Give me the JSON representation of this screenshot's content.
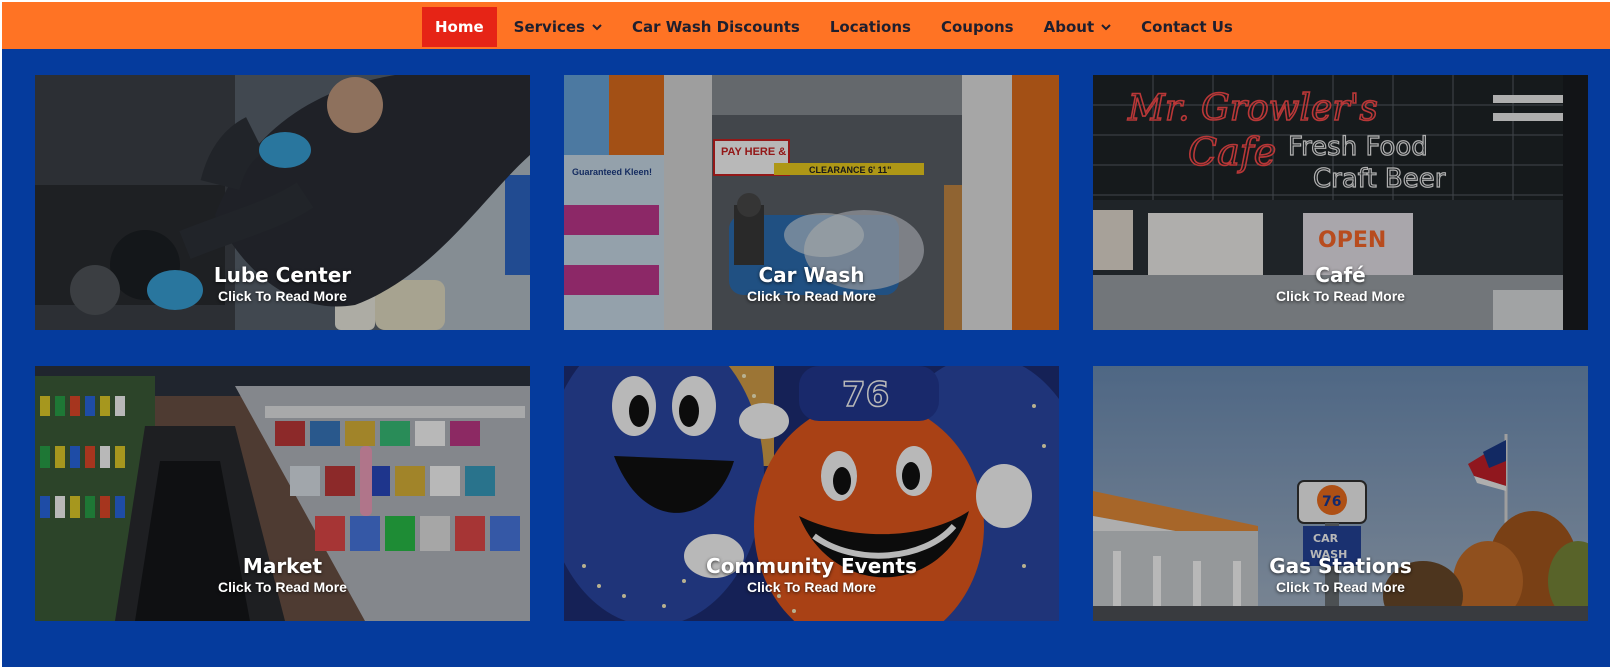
{
  "colors": {
    "nav_background": "#ff7324",
    "nav_active": "#e62416",
    "main_background": "#053b9d",
    "nav_text": "#1f1f2e"
  },
  "nav": {
    "items": [
      {
        "label": "Home",
        "active": true,
        "dropdown": false
      },
      {
        "label": "Services",
        "active": false,
        "dropdown": true,
        "icon": "chevron-down-icon"
      },
      {
        "label": "Car Wash Discounts",
        "active": false,
        "dropdown": false
      },
      {
        "label": "Locations",
        "active": false,
        "dropdown": false
      },
      {
        "label": "Coupons",
        "active": false,
        "dropdown": false
      },
      {
        "label": "About",
        "active": false,
        "dropdown": true,
        "icon": "chevron-down-icon"
      },
      {
        "label": "Contact Us",
        "active": false,
        "dropdown": false
      }
    ]
  },
  "cards": [
    {
      "title": "Lube Center",
      "subtitle": "Click To Read More"
    },
    {
      "title": "Car Wash",
      "subtitle": "Click To Read More"
    },
    {
      "title": "Café",
      "subtitle": "Click To Read More"
    },
    {
      "title": "Market",
      "subtitle": "Click To Read More"
    },
    {
      "title": "Community Events",
      "subtitle": "Click To Read More"
    },
    {
      "title": "Gas Stations",
      "subtitle": "Click To Read More"
    }
  ],
  "images": {
    "lube": {
      "labels": []
    },
    "carwash": {
      "labels": [
        "PAY HERE &",
        "CLEARANCE 6' 11\"",
        "Guaranteed Kleen!"
      ]
    },
    "cafe": {
      "labels": [
        "Mr. Growler's",
        "Cafe",
        "Fresh Food",
        "Craft Beer",
        "OPEN"
      ]
    },
    "market": {
      "labels": []
    },
    "events": {
      "labels": [
        "76"
      ]
    },
    "gas": {
      "labels": [
        "76",
        "CAR",
        "WASH"
      ]
    }
  }
}
